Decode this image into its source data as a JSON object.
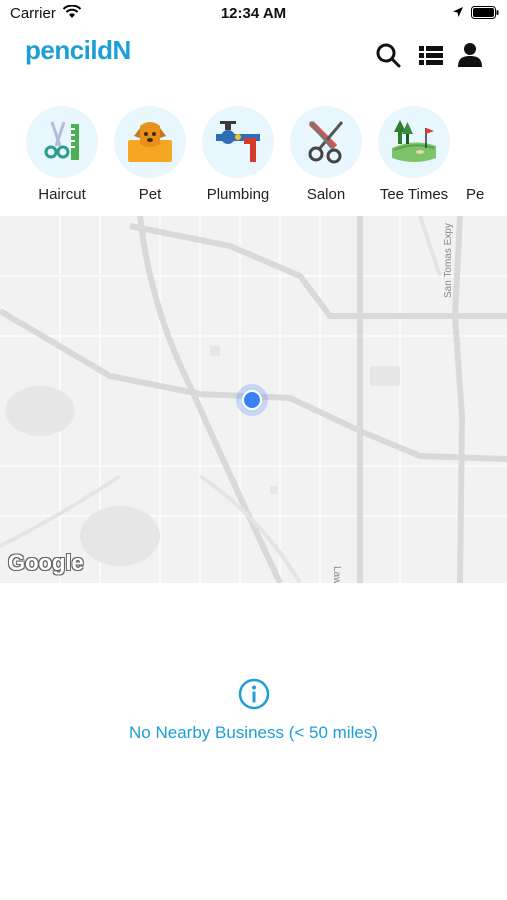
{
  "status_bar": {
    "carrier": "Carrier",
    "time": "12:34 AM"
  },
  "header": {
    "brand": "pencildN",
    "actions": [
      "search-icon",
      "list-icon",
      "profile-icon"
    ],
    "accent_color": "#1b9fd6"
  },
  "categories": [
    {
      "label": "Haircut",
      "icon": "haircut-icon"
    },
    {
      "label": "Pet",
      "icon": "pet-icon"
    },
    {
      "label": "Plumbing",
      "icon": "plumbing-icon"
    },
    {
      "label": "Salon",
      "icon": "salon-icon"
    },
    {
      "label": "Tee Times",
      "icon": "golf-icon"
    },
    {
      "label": "Pe",
      "icon": ""
    }
  ],
  "map": {
    "road_labels": [
      "Lawrence Expy",
      "San Tomas Expy"
    ],
    "attribution": "Google"
  },
  "empty_state": {
    "icon": "info-icon",
    "message": "No Nearby Business (< 50 miles)"
  }
}
